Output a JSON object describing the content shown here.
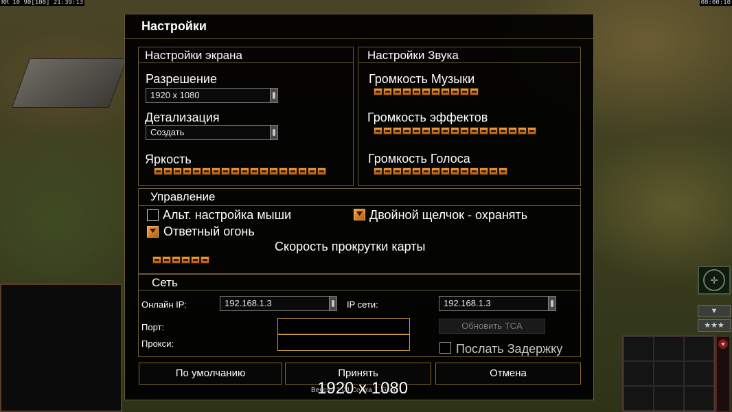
{
  "hud": {
    "top_left": "RR 10 90[100] 21:39:13",
    "top_right": "00:00:10",
    "version": "Версия 1.04 Contra X Final",
    "resolution_overlay": "1920 x 1080",
    "arrow": "▼",
    "stars": "★★★",
    "radar_symbol": "✛"
  },
  "dialog": {
    "title": "Настройки",
    "screen": {
      "header": "Настройки экрана",
      "resolution_label": "Разрешение",
      "resolution_value": "1920 x 1080",
      "detail_label": "Детализация",
      "detail_value": "Создать",
      "brightness_label": "Яркость",
      "brightness_level": 18
    },
    "sound": {
      "header": "Настройки Звука",
      "music_label": "Громкость Музыки",
      "music_level": 11,
      "effects_label": "Громкость эффектов",
      "effects_level": 17,
      "voice_label": "Громкость Голоса",
      "voice_level": 14
    },
    "controls": {
      "header": "Управление",
      "alt_mouse_label": "Альт. настройка мыши",
      "alt_mouse_checked": false,
      "double_click_label": "Двойной щелчок - охранять",
      "double_click_checked": true,
      "return_fire_label": "Ответный огонь",
      "return_fire_checked": true,
      "scroll_speed_label": "Скорость прокрутки карты",
      "scroll_speed_level": 6
    },
    "network": {
      "header": "Сеть",
      "online_ip_label": "Онлайн IP:",
      "online_ip_value": "192.168.1.3",
      "lan_ip_label": "IP сети:",
      "lan_ip_value": "192.168.1.3",
      "port_label": "Порт:",
      "port_value": "",
      "proxy_label": "Прокси:",
      "proxy_value": "",
      "update_tca_label": "Обновить TCA",
      "send_delay_label": "Послать Задержку",
      "send_delay_checked": false
    },
    "buttons": {
      "defaults": "По умолчанию",
      "accept": "Принять",
      "cancel": "Отмена"
    }
  }
}
